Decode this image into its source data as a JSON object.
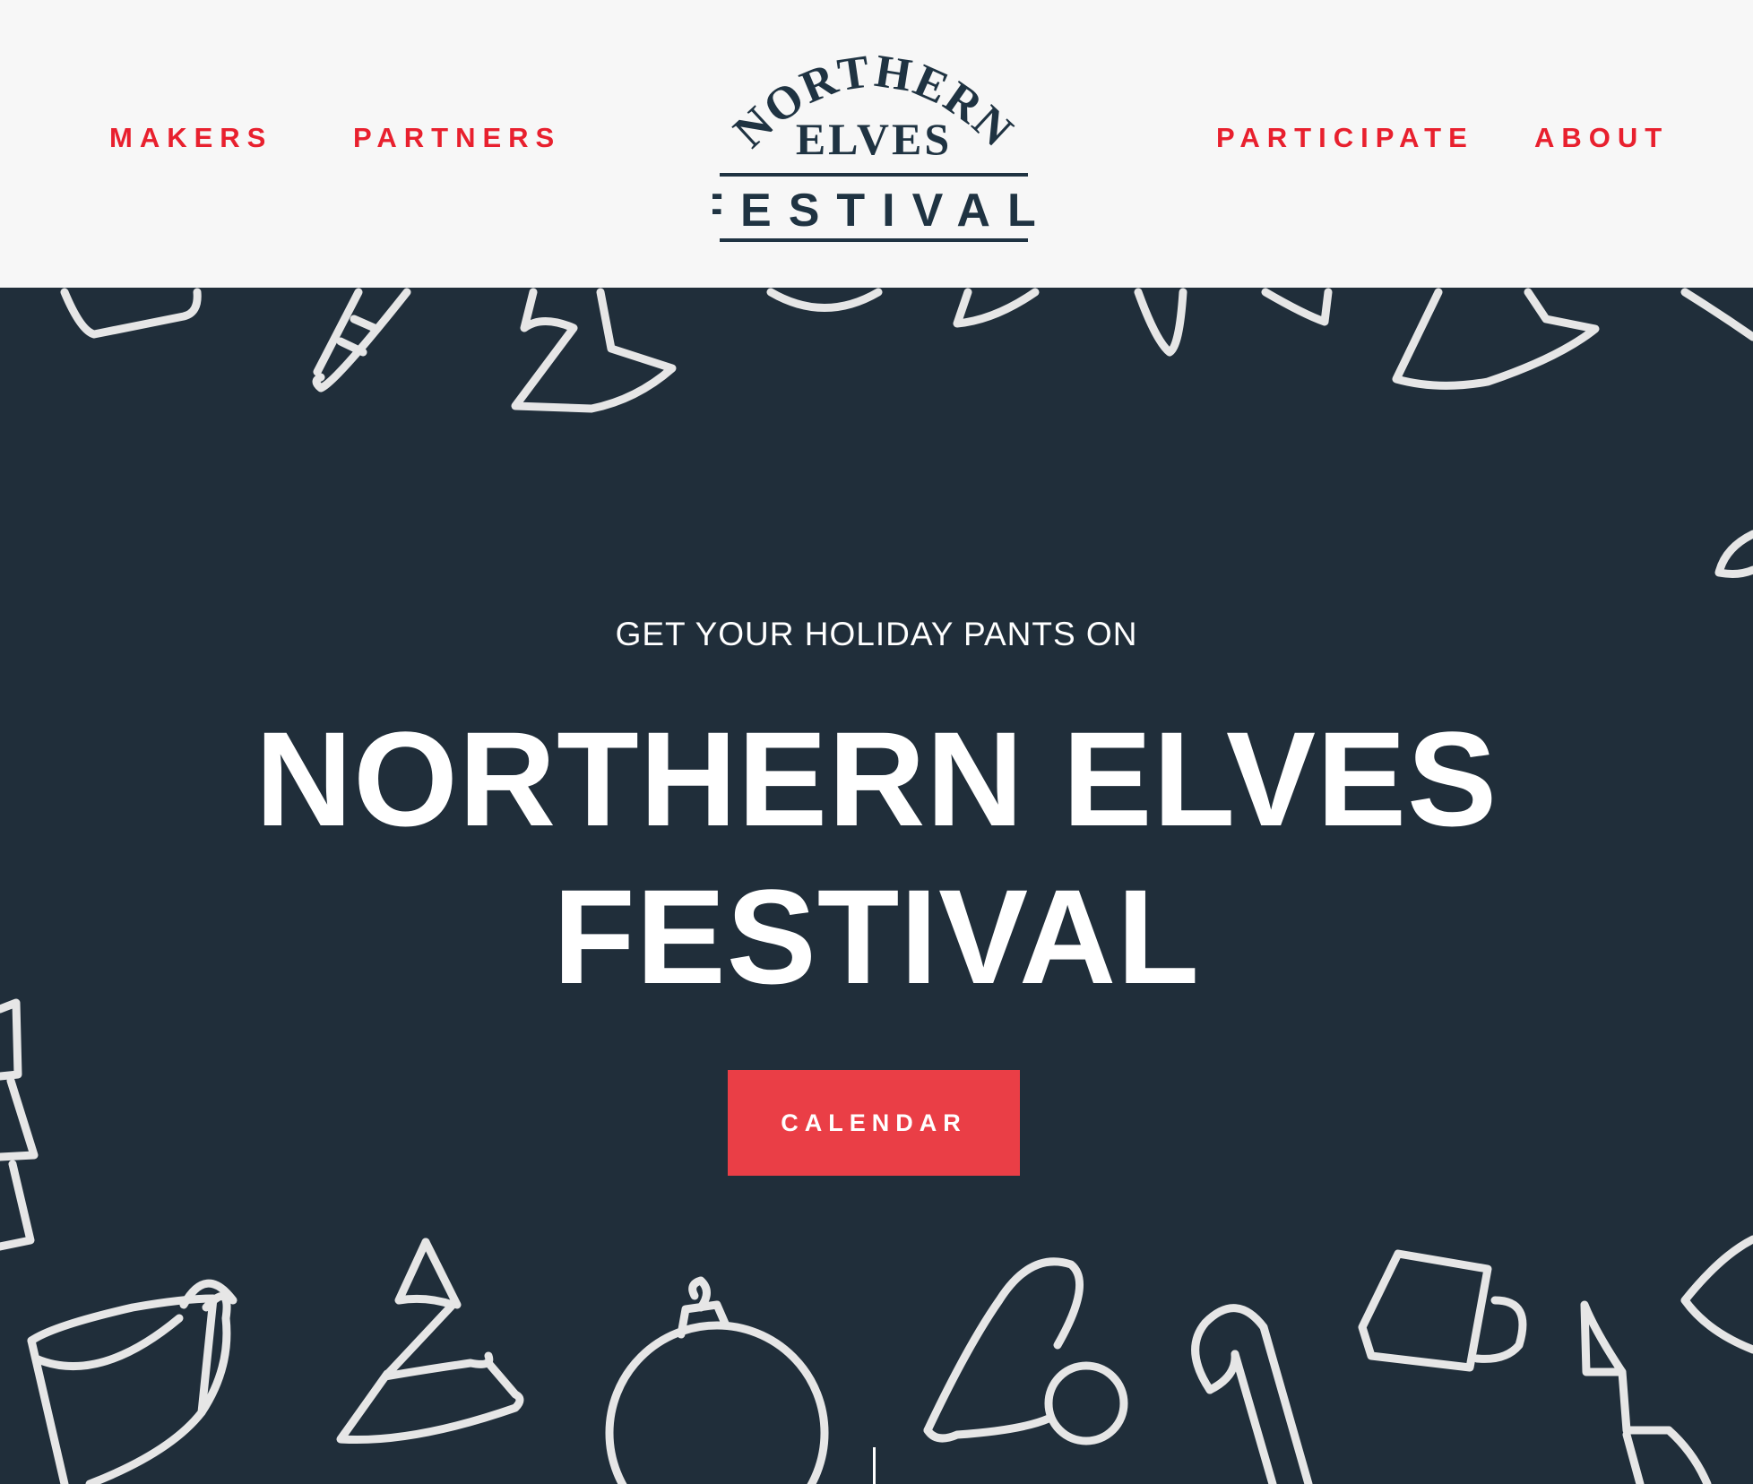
{
  "header": {
    "nav_left": [
      {
        "label": "MAKERS"
      },
      {
        "label": "PARTNERS"
      }
    ],
    "nav_right": [
      {
        "label": "PARTICIPATE"
      },
      {
        "label": "ABOUT"
      }
    ],
    "logo": {
      "arc_text": "NORTHERN",
      "middle_text": "ELVES",
      "bottom_text": "FESTIVAL"
    }
  },
  "hero": {
    "tagline": "GET YOUR HOLIDAY PANTS ON",
    "headline_line1": "NORTHERN ELVES",
    "headline_line2": "FESTIVAL",
    "cta_label": "CALENDAR",
    "doodle_icons": [
      "mug-icon",
      "candy-cane-icon",
      "christmas-tree-icon",
      "elf-hat-icon",
      "ornament-icon",
      "coffee-cup-icon"
    ]
  },
  "colors": {
    "nav_red": "#e8202e",
    "header_bg": "#f7f7f7",
    "hero_bg": "#202e3a",
    "cta_bg": "#ea3e46",
    "logo_navy": "#1f3342"
  }
}
